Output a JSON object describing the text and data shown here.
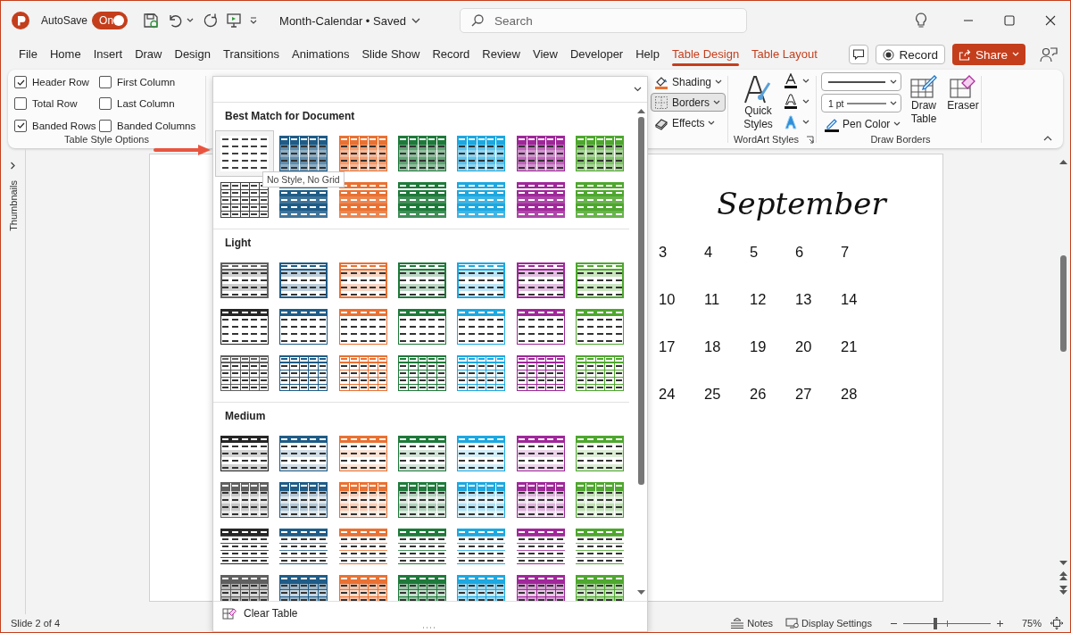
{
  "titlebar": {
    "autosave_label": "AutoSave",
    "autosave": {
      "on": true,
      "label": "On"
    },
    "document_title": "Month-Calendar • Saved",
    "search": {
      "placeholder": "Search"
    }
  },
  "tabs": [
    {
      "label": "File",
      "kind": "standard",
      "selected": false
    },
    {
      "label": "Home",
      "kind": "standard",
      "selected": false
    },
    {
      "label": "Insert",
      "kind": "standard",
      "selected": false
    },
    {
      "label": "Draw",
      "kind": "standard",
      "selected": false
    },
    {
      "label": "Design",
      "kind": "standard",
      "selected": false
    },
    {
      "label": "Transitions",
      "kind": "standard",
      "selected": false
    },
    {
      "label": "Animations",
      "kind": "standard",
      "selected": false
    },
    {
      "label": "Slide Show",
      "kind": "standard",
      "selected": false
    },
    {
      "label": "Record",
      "kind": "standard",
      "selected": false
    },
    {
      "label": "Review",
      "kind": "standard",
      "selected": false
    },
    {
      "label": "View",
      "kind": "standard",
      "selected": false
    },
    {
      "label": "Developer",
      "kind": "standard",
      "selected": false
    },
    {
      "label": "Help",
      "kind": "standard",
      "selected": false
    },
    {
      "label": "Table Design",
      "kind": "contextual",
      "selected": true
    },
    {
      "label": "Table Layout",
      "kind": "contextual",
      "selected": false
    }
  ],
  "actions": {
    "record": "Record",
    "share": "Share"
  },
  "ribbon": {
    "table_style_options": {
      "label": "Table Style Options",
      "options": [
        {
          "label": "Header Row",
          "checked": true
        },
        {
          "label": "First Column",
          "checked": false
        },
        {
          "label": "Total Row",
          "checked": false
        },
        {
          "label": "Last Column",
          "checked": false
        },
        {
          "label": "Banded Rows",
          "checked": true
        },
        {
          "label": "Banded Columns",
          "checked": false
        }
      ]
    },
    "table_tools": [
      {
        "label": "Shading",
        "kind": "shading",
        "selected": false
      },
      {
        "label": "Borders",
        "kind": "borders",
        "selected": true
      },
      {
        "label": "Effects",
        "kind": "effects",
        "selected": false
      }
    ],
    "wordart": {
      "label": "WordArt Styles",
      "quick_styles": "Quick Styles"
    },
    "draw_borders": {
      "label": "Draw Borders",
      "pen_weight": "1 pt",
      "pen_color": "Pen Color",
      "draw_table": "Draw Table",
      "eraser": "Eraser"
    }
  },
  "gallery": {
    "sections": [
      {
        "title": "Best Match for Document",
        "rows": [
          {
            "items": [
              {
                "kind": "none",
                "selected": true
              },
              {
                "kind": "filled",
                "color": "#1f5c87",
                "selected": false
              },
              {
                "kind": "filled",
                "color": "#e97132",
                "selected": false
              },
              {
                "kind": "filled",
                "color": "#1e7a3a",
                "selected": false
              },
              {
                "kind": "filled",
                "color": "#1ca8e0",
                "selected": false
              },
              {
                "kind": "filled",
                "color": "#a0279a",
                "selected": false
              },
              {
                "kind": "filled",
                "color": "#4ea72e",
                "selected": false
              }
            ]
          },
          {
            "items": [
              {
                "kind": "grid",
                "selected": false
              },
              {
                "kind": "dark",
                "color": "#1f5c87",
                "selected": false
              },
              {
                "kind": "dark",
                "color": "#e97132",
                "selected": false
              },
              {
                "kind": "dark",
                "color": "#1e7a3a",
                "selected": false
              },
              {
                "kind": "dark",
                "color": "#1ca8e0",
                "selected": false
              },
              {
                "kind": "dark",
                "color": "#a0279a",
                "selected": false
              },
              {
                "kind": "dark",
                "color": "#4ea72e",
                "selected": false
              }
            ]
          }
        ]
      },
      {
        "title": "Light",
        "rows": [
          {
            "items": [
              {
                "kind": "light",
                "color": "#606060",
                "selected": false
              },
              {
                "kind": "light",
                "color": "#1f5c87",
                "selected": false
              },
              {
                "kind": "light",
                "color": "#e97132",
                "selected": false
              },
              {
                "kind": "light",
                "color": "#1e7a3a",
                "selected": false
              },
              {
                "kind": "light",
                "color": "#1ca8e0",
                "selected": false
              },
              {
                "kind": "light",
                "color": "#a0279a",
                "selected": false
              },
              {
                "kind": "light",
                "color": "#4ea72e",
                "selected": false
              }
            ]
          },
          {
            "items": [
              {
                "kind": "light-header",
                "color": "#262626",
                "selected": false
              },
              {
                "kind": "light-header",
                "color": "#1f5c87",
                "selected": false
              },
              {
                "kind": "light-header",
                "color": "#e97132",
                "selected": false
              },
              {
                "kind": "light-header",
                "color": "#1e7a3a",
                "selected": false
              },
              {
                "kind": "light-header",
                "color": "#1ca8e0",
                "selected": false
              },
              {
                "kind": "light-header",
                "color": "#a0279a",
                "selected": false
              },
              {
                "kind": "light-header",
                "color": "#4ea72e",
                "selected": false
              }
            ]
          },
          {
            "items": [
              {
                "kind": "light-grid",
                "color": "#606060",
                "selected": false
              },
              {
                "kind": "light-grid",
                "color": "#1f5c87",
                "selected": false
              },
              {
                "kind": "light-grid",
                "color": "#e97132",
                "selected": false
              },
              {
                "kind": "light-grid",
                "color": "#1e7a3a",
                "selected": false
              },
              {
                "kind": "light-grid",
                "color": "#1ca8e0",
                "selected": false
              },
              {
                "kind": "light-grid",
                "color": "#a0279a",
                "selected": false
              },
              {
                "kind": "light-grid",
                "color": "#4ea72e",
                "selected": false
              }
            ]
          }
        ]
      },
      {
        "title": "Medium",
        "rows": [
          {
            "items": [
              {
                "kind": "medium-header",
                "color": "#262626",
                "selected": false
              },
              {
                "kind": "medium-header",
                "color": "#1f5c87",
                "selected": false
              },
              {
                "kind": "medium-header",
                "color": "#e97132",
                "selected": false
              },
              {
                "kind": "medium-header",
                "color": "#1e7a3a",
                "selected": false
              },
              {
                "kind": "medium-header",
                "color": "#1ca8e0",
                "selected": false
              },
              {
                "kind": "medium-header",
                "color": "#a0279a",
                "selected": false
              },
              {
                "kind": "medium-header",
                "color": "#4ea72e",
                "selected": false
              }
            ]
          },
          {
            "items": [
              {
                "kind": "medium-banded",
                "color": "#606060",
                "selected": false
              },
              {
                "kind": "medium-banded",
                "color": "#1f5c87",
                "selected": false
              },
              {
                "kind": "medium-banded",
                "color": "#e97132",
                "selected": false
              },
              {
                "kind": "medium-banded",
                "color": "#1e7a3a",
                "selected": false
              },
              {
                "kind": "medium-banded",
                "color": "#1ca8e0",
                "selected": false
              },
              {
                "kind": "medium-banded",
                "color": "#a0279a",
                "selected": false
              },
              {
                "kind": "medium-banded",
                "color": "#4ea72e",
                "selected": false
              }
            ]
          },
          {
            "items": [
              {
                "kind": "medium-top",
                "color": "#262626",
                "selected": false
              },
              {
                "kind": "medium-top",
                "color": "#1f5c87",
                "selected": false
              },
              {
                "kind": "medium-top",
                "color": "#e97132",
                "selected": false
              },
              {
                "kind": "medium-top",
                "color": "#1e7a3a",
                "selected": false
              },
              {
                "kind": "medium-top",
                "color": "#1ca8e0",
                "selected": false
              },
              {
                "kind": "medium-top",
                "color": "#a0279a",
                "selected": false
              },
              {
                "kind": "medium-top",
                "color": "#4ea72e",
                "selected": false
              }
            ]
          },
          {
            "items": [
              {
                "kind": "medium-grid",
                "color": "#606060",
                "selected": false
              },
              {
                "kind": "medium-grid",
                "color": "#1f5c87",
                "selected": false
              },
              {
                "kind": "medium-grid",
                "color": "#e97132",
                "selected": false
              },
              {
                "kind": "medium-grid",
                "color": "#1e7a3a",
                "selected": false
              },
              {
                "kind": "medium-grid",
                "color": "#1ca8e0",
                "selected": false
              },
              {
                "kind": "medium-grid",
                "color": "#a0279a",
                "selected": false
              },
              {
                "kind": "medium-grid",
                "color": "#4ea72e",
                "selected": false
              }
            ]
          }
        ]
      }
    ],
    "tooltip": "No Style, No Grid",
    "footer": "Clear Table"
  },
  "thumbnails_pane": {
    "label": "Thumbnails"
  },
  "slide": {
    "title": "September",
    "weeks": [
      [
        "3",
        "4",
        "5",
        "6",
        "7"
      ],
      [
        "10",
        "11",
        "12",
        "13",
        "14"
      ],
      [
        "17",
        "18",
        "19",
        "20",
        "21"
      ],
      [
        "24",
        "25",
        "26",
        "27",
        "28"
      ]
    ]
  },
  "status_bar": {
    "slide": "Slide 2 of 4",
    "notes": "Notes",
    "display_settings": "Display Settings",
    "zoom": {
      "level": 0.37,
      "label": "75%"
    }
  }
}
